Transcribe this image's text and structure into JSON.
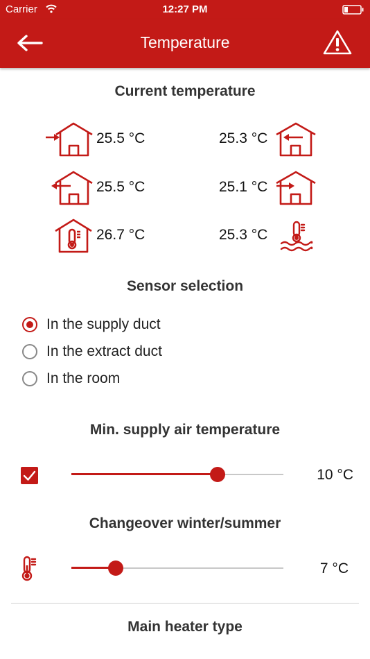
{
  "status_bar": {
    "carrier": "Carrier",
    "time": "12:27 PM"
  },
  "nav": {
    "title": "Temperature",
    "back_icon": "arrow-left-icon",
    "warning_icon": "warning-triangle-icon"
  },
  "current_temperature": {
    "title": "Current temperature",
    "left": [
      {
        "icon": "outdoor-air-intake-icon",
        "value": "25.5 °C"
      },
      {
        "icon": "exhaust-air-out-icon",
        "value": "25.5 °C"
      },
      {
        "icon": "room-thermometer-icon",
        "value": "26.7 °C"
      }
    ],
    "right": [
      {
        "icon": "extract-air-in-icon",
        "value": "25.3 °C"
      },
      {
        "icon": "supply-air-in-icon",
        "value": "25.1 °C"
      },
      {
        "icon": "water-thermometer-icon",
        "value": "25.3 °C"
      }
    ]
  },
  "sensor_selection": {
    "title": "Sensor selection",
    "options": [
      {
        "label": "In the supply duct",
        "selected": true
      },
      {
        "label": "In the extract duct",
        "selected": false
      },
      {
        "label": "In the room",
        "selected": false
      }
    ]
  },
  "min_supply": {
    "title": "Min. supply air temperature",
    "checked": true,
    "value_label": "10 °C",
    "slider_fraction": 0.69
  },
  "changeover": {
    "title": "Changeover winter/summer",
    "icon": "thermometer-icon",
    "value_label": "7 °C",
    "slider_fraction": 0.21
  },
  "main_heater": {
    "title": "Main heater type"
  },
  "colors": {
    "accent": "#c31a17",
    "track": "#c8c8c8"
  }
}
